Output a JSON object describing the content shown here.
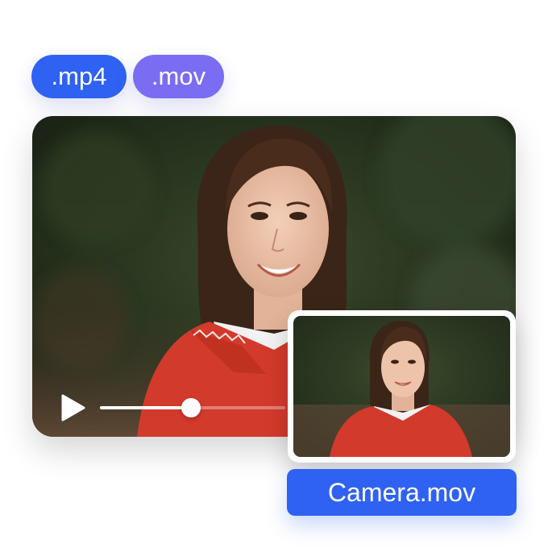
{
  "formats": {
    "mp4_label": ".mp4",
    "mov_label": ".mov",
    "mp4_color": "#2f62f2",
    "mov_color": "#7a6cf3"
  },
  "player": {
    "progress": 0.49,
    "play_icon": "play-icon"
  },
  "camera_preview": {
    "filename": "Camera.mov"
  },
  "colors": {
    "accent": "#2f62f2",
    "jacket": "#d23a2c",
    "foliage": "#2c3a22"
  }
}
